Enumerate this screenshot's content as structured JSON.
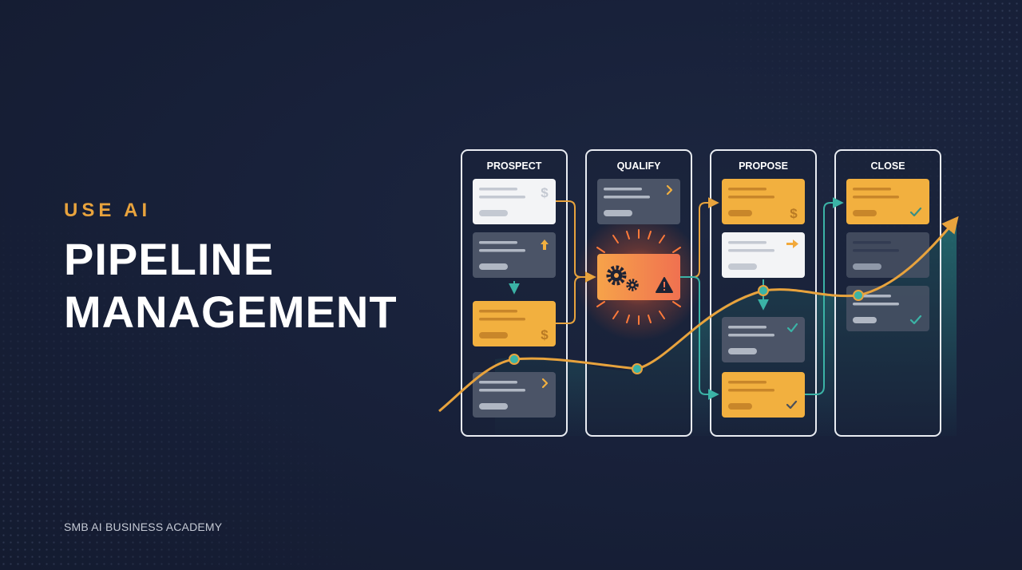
{
  "hero": {
    "eyebrow": "USE AI",
    "title_line1": "PIPELINE",
    "title_line2": "MANAGEMENT"
  },
  "footer": {
    "brand": "SMB AI BUSINESS ACADEMY"
  },
  "pipeline": {
    "stages": [
      "PROSPECT",
      "QUALIFY",
      "PROPOSE",
      "CLOSE"
    ],
    "cards": {
      "prospect": [
        "light dollar card",
        "gray up-arrow card",
        "orange dollar card",
        "gray chevron card"
      ],
      "qualify": [
        "gray chevron card",
        "ai processing card"
      ],
      "propose": [
        "orange dollar card",
        "light arrow card",
        "gray check card",
        "orange check card"
      ],
      "close": [
        "orange check card",
        "gray card",
        "gray check card"
      ]
    }
  },
  "colors": {
    "background": "#18213a",
    "accent_orange": "#f2b03f",
    "accent_teal": "#3bb3a6",
    "eyebrow_orange": "#e8a33d",
    "card_gray": "#4b5467",
    "card_light": "#f3f4f6",
    "alert_red": "#f06a3c"
  },
  "icons": [
    "dollar-icon",
    "up-arrow-icon",
    "down-arrow-icon",
    "chevron-right-icon",
    "right-arrow-icon",
    "check-icon",
    "gear-icon",
    "warning-icon"
  ]
}
